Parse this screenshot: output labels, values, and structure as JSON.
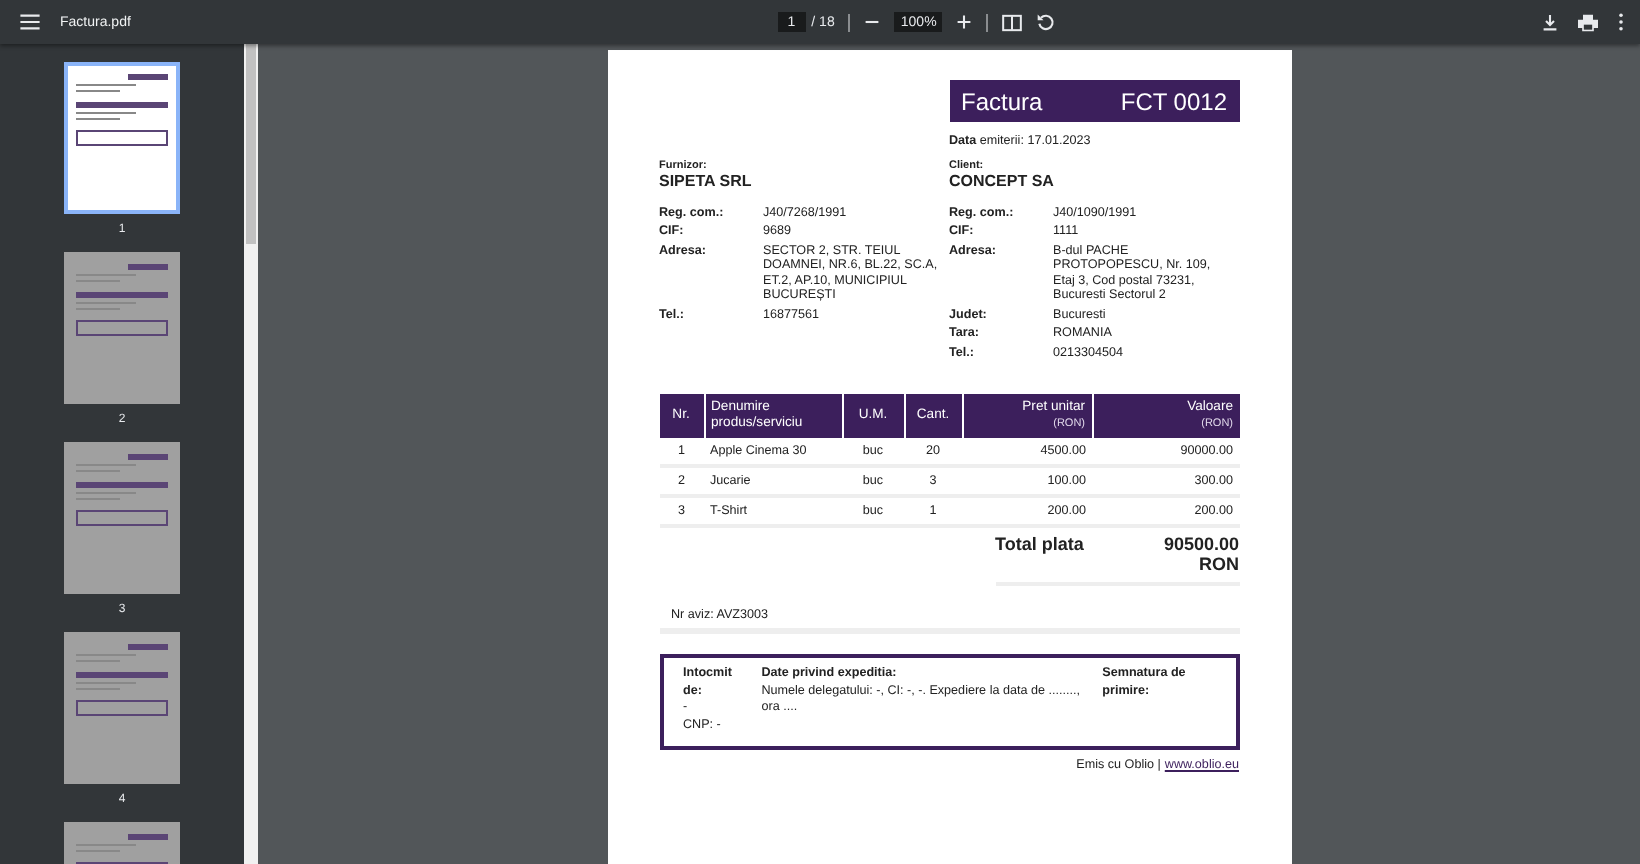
{
  "toolbar": {
    "title": "Factura.pdf",
    "page_input": "1",
    "page_total": "/ 18",
    "zoom": "100%"
  },
  "thumbnails": [
    {
      "label": "1",
      "selected": true
    },
    {
      "label": "2",
      "selected": false
    },
    {
      "label": "3",
      "selected": false
    },
    {
      "label": "4",
      "selected": false
    },
    {
      "selected": false
    }
  ],
  "invoice": {
    "title": "Factura",
    "number": "FCT 0012",
    "date": "**Data** emiterii: 17.01.2023",
    "supplier": {
      "label": "Furnizor:",
      "name": "SIPETA SRL",
      "fields": [
        {
          "label": "Reg. com.:",
          "value": "J40/7268/1991"
        },
        {
          "label": "CIF:",
          "value": "9689"
        },
        {
          "label": "Adresa:",
          "value": "SECTOR 2, STR. TEIUL DOAMNEI, NR.6, BL.22, SC.A, ET.2, AP.10, MUNICIPIUL BUCUREȘTI"
        },
        {
          "label": "Tel.:",
          "value": "16877561"
        }
      ]
    },
    "client": {
      "label": "Client:",
      "name": "CONCEPT SA",
      "fields": [
        {
          "label": "Reg. com.:",
          "value": "J40/1090/1991"
        },
        {
          "label": "CIF:",
          "value": "1111"
        },
        {
          "label": "Adresa:",
          "value": "B-dul PACHE PROTOPOPESCU, Nr. 109, Etaj 3, Cod postal 73231, Bucuresti Sectorul 2"
        },
        {
          "label": "Judet:",
          "value": "Bucuresti"
        },
        {
          "label": "Tara:",
          "value": "ROMANIA"
        },
        {
          "label": "Tel.:",
          "value": "0213304504"
        }
      ]
    },
    "table": {
      "columns": [
        {
          "label": "Nr."
        },
        {
          "label": "Denumire produs/serviciu"
        },
        {
          "label": "U.M."
        },
        {
          "label": "Cant."
        },
        {
          "label": "Pret unitar",
          "unit": "(RON)"
        },
        {
          "label": "Valoare",
          "unit": "(RON)"
        }
      ],
      "rows": [
        [
          "1",
          "Apple Cinema 30",
          "buc",
          "20",
          "4500.00",
          "90000.00"
        ],
        [
          "2",
          "Jucarie",
          "buc",
          "3",
          "100.00",
          "300.00"
        ],
        [
          "3",
          "T-Shirt",
          "buc",
          "1",
          "200.00",
          "200.00"
        ]
      ]
    },
    "total_label": "Total plata",
    "total_value": "90500.00 RON",
    "aviz": "Nr aviz: AVZ3003",
    "shipping": {
      "issued_by_label": "Intocmit de:",
      "issued_by_lines": [
        "-",
        "CNP: -"
      ],
      "details_label": "Date privind expeditia:",
      "details_text": "Numele delegatului: -, CI: -, -. Expediere la data de ........, ora ....",
      "signature_label": "Semnatura de primire:"
    },
    "footer_text": "Emis cu Oblio |",
    "footer_link": "www.oblio.eu"
  }
}
